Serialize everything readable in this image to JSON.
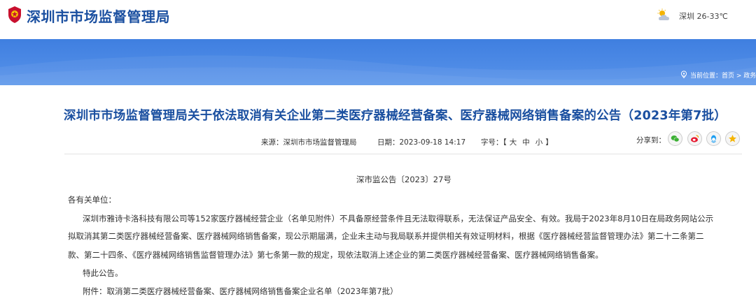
{
  "header": {
    "site_title": "深圳市市场监督管理局",
    "weather": "深圳 26-33℃"
  },
  "breadcrumb": {
    "prefix": "当前位置：",
    "items": [
      "首页",
      "政务"
    ]
  },
  "article": {
    "title": "深圳市市场监督管理局关于依法取消有关企业第二类医疗器械经营备案、医疗器械网络销售备案的公告（2023年第7批）",
    "source_label": "来源：",
    "source": "深圳市市场监督管理局",
    "date_label": "日期：",
    "date": "2023-09-18 14:17",
    "font_label": "字号：",
    "font_sizes": [
      "大",
      "中",
      "小"
    ],
    "share_label": "分享到：",
    "share_targets": [
      "wechat-icon",
      "weibo-icon",
      "qq-icon",
      "qzone-icon"
    ],
    "doc_number": "深市监公告〔2023〕27号",
    "lines": [
      "各有关单位：",
      "深圳市雅诗卡洛科技有限公司等152家医疗器械经营企业（名单见附件）不具备原经营条件且无法取得联系，无法保证产品安全、有效。我局于2023年8月10日在局政务网站公示",
      "拟取消其第二类医疗器械经营备案、医疗器械网络销售备案，现公示期届满，企业未主动与我局联系并提供相关有效证明材料，根据《医疗器械经营监督管理办法》第二十二条第二",
      "款、第二十四条、《医疗器械网络销售监督管理办法》第七条第一款的规定，现依法取消上述企业的第二类医疗器械经营备案、医疗器械网络销售备案。",
      "特此公告。",
      "附件：取消第二类医疗器械经营备案、医疗器械网络销售备案企业名单（2023年第7批）"
    ]
  },
  "colors": {
    "brand_blue": "#1a4fa0",
    "banner_blue": "#4e8be6",
    "share_wechat": "#3cb034",
    "share_weibo": "#e6162d",
    "share_qq": "#1e9ff2",
    "share_qzone": "#f5b400"
  }
}
